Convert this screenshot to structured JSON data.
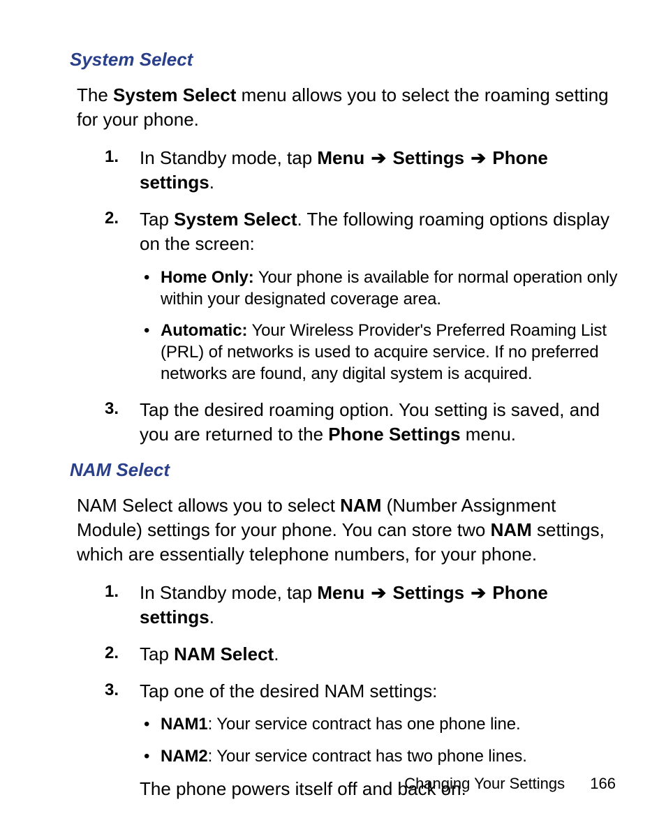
{
  "section1": {
    "heading": "System Select",
    "intro_pre": "The ",
    "intro_bold": "System Select",
    "intro_post": " menu allows you to select the roaming setting for your phone.",
    "step1_pre": "In Standby mode, tap ",
    "step1_b1": "Menu",
    "step1_b2": "Settings",
    "step1_b3": "Phone settings",
    "step2_pre": "Tap ",
    "step2_bold": "System Select",
    "step2_post": ". The following roaming options display on the screen:",
    "bullet1_bold": "Home Only:",
    "bullet1_text": " Your phone is available for normal operation only within your designated coverage area.",
    "bullet2_bold": "Automatic:",
    "bullet2_text": " Your Wireless Provider's Preferred Roaming List (PRL) of networks is used to acquire service. If no preferred networks are found, any digital system is acquired.",
    "step3_pre": "Tap the desired roaming option. You setting is saved, and you are returned to the ",
    "step3_bold": "Phone Settings",
    "step3_post": " menu."
  },
  "section2": {
    "heading": "NAM Select",
    "intro_pre": "NAM Select allows you to select ",
    "intro_b1": "NAM",
    "intro_mid": " (Number Assignment Module) settings for your phone. You can store two ",
    "intro_b2": "NAM",
    "intro_post": " settings, which are essentially telephone numbers, for your phone.",
    "step1_pre": "In Standby mode, tap ",
    "step1_b1": "Menu",
    "step1_b2": "Settings",
    "step1_b3": "Phone settings",
    "step2_pre": "Tap ",
    "step2_bold": "NAM Select",
    "step3_text": "Tap one of the desired NAM settings:",
    "bullet1_bold": "NAM1",
    "bullet1_text": ": Your service contract has one phone line.",
    "bullet2_bold": "NAM2",
    "bullet2_text": ": Your service contract has two phone lines.",
    "step3_tail": "The phone powers itself off and back on."
  },
  "arrow": "➔",
  "period": ".",
  "footer": {
    "title": "Changing Your Settings",
    "page": "166"
  }
}
